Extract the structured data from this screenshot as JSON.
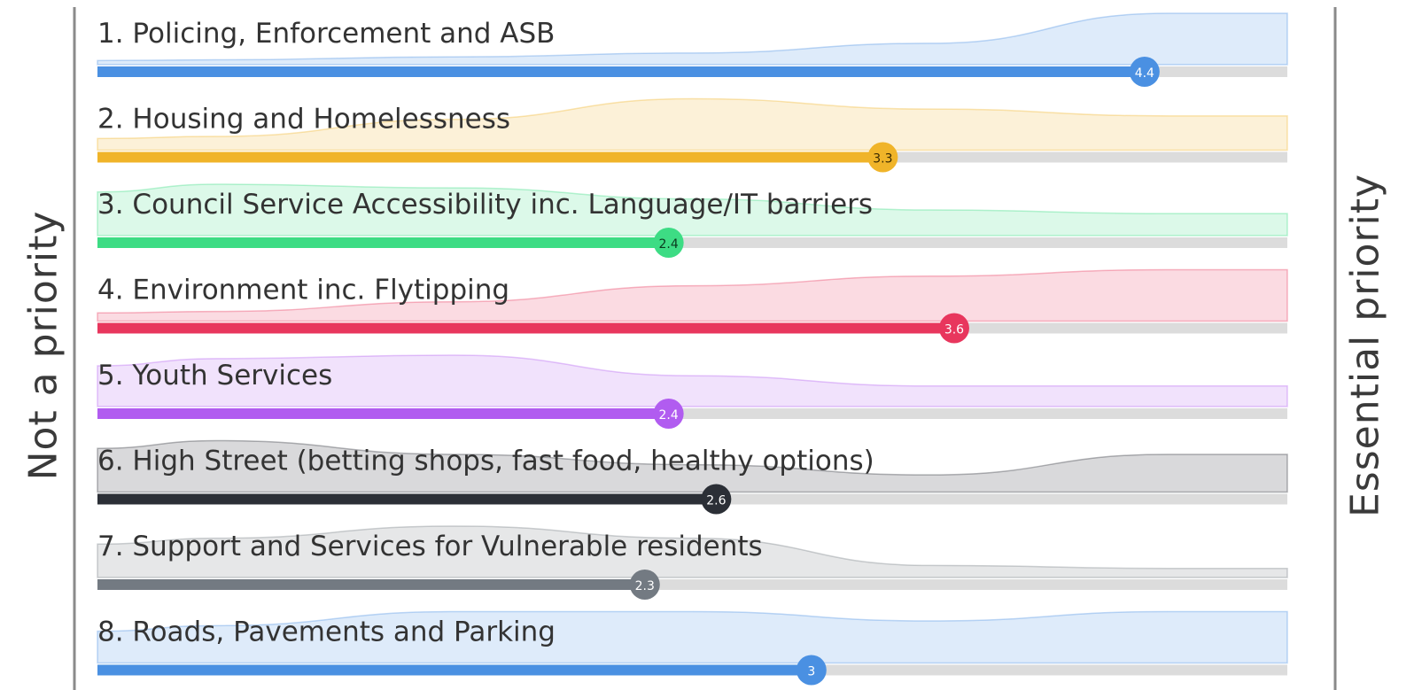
{
  "chart_data": {
    "type": "bar",
    "orientation": "horizontal",
    "left_label": "Not a priority",
    "right_label": "Essential priority",
    "xlim": [
      0,
      5
    ],
    "grid": false,
    "items": [
      {
        "label": "1. Policing, Enforcement and ASB",
        "value": 4.4,
        "display": "4.4",
        "color": "#4a90e2",
        "text_color": "#ffffff",
        "distribution": [
          0.05,
          0.08,
          0.12,
          0.22,
          0.53
        ]
      },
      {
        "label": "2. Housing and Homelessness",
        "value": 3.3,
        "display": "3.3",
        "color": "#f0b429",
        "text_color": "#3a2a00",
        "distribution": [
          0.08,
          0.18,
          0.3,
          0.24,
          0.2
        ]
      },
      {
        "label": "3. Council Service Accessibility inc. Language/IT barriers",
        "value": 2.4,
        "display": "2.4",
        "color": "#3ddc84",
        "text_color": "#0b3a1f",
        "distribution": [
          0.28,
          0.26,
          0.2,
          0.14,
          0.12
        ]
      },
      {
        "label": "4. Environment inc. Flytipping",
        "value": 3.6,
        "display": "3.6",
        "color": "#e8365d",
        "text_color": "#ffffff",
        "distribution": [
          0.06,
          0.12,
          0.22,
          0.28,
          0.32
        ]
      },
      {
        "label": "5. Youth Services",
        "value": 2.4,
        "display": "2.4",
        "color": "#b15cf0",
        "text_color": "#ffffff",
        "distribution": [
          0.28,
          0.3,
          0.18,
          0.12,
          0.12
        ]
      },
      {
        "label": "6. High Street (betting shops, fast food, healthy options)",
        "value": 2.6,
        "display": "2.6",
        "color": "#2b2f36",
        "text_color": "#ffffff",
        "distribution": [
          0.3,
          0.22,
          0.16,
          0.1,
          0.22
        ]
      },
      {
        "label": "7. Support and Services for Vulnerable residents",
        "value": 2.3,
        "display": "2.3",
        "color": "#737a82",
        "text_color": "#ffffff",
        "distribution": [
          0.26,
          0.34,
          0.26,
          0.08,
          0.06
        ]
      },
      {
        "label": "8. Roads, Pavements and Parking",
        "value": 3.0,
        "display": "3",
        "color": "#4a90e2",
        "text_color": "#ffffff",
        "distribution": [
          0.16,
          0.22,
          0.22,
          0.18,
          0.22
        ]
      }
    ]
  }
}
